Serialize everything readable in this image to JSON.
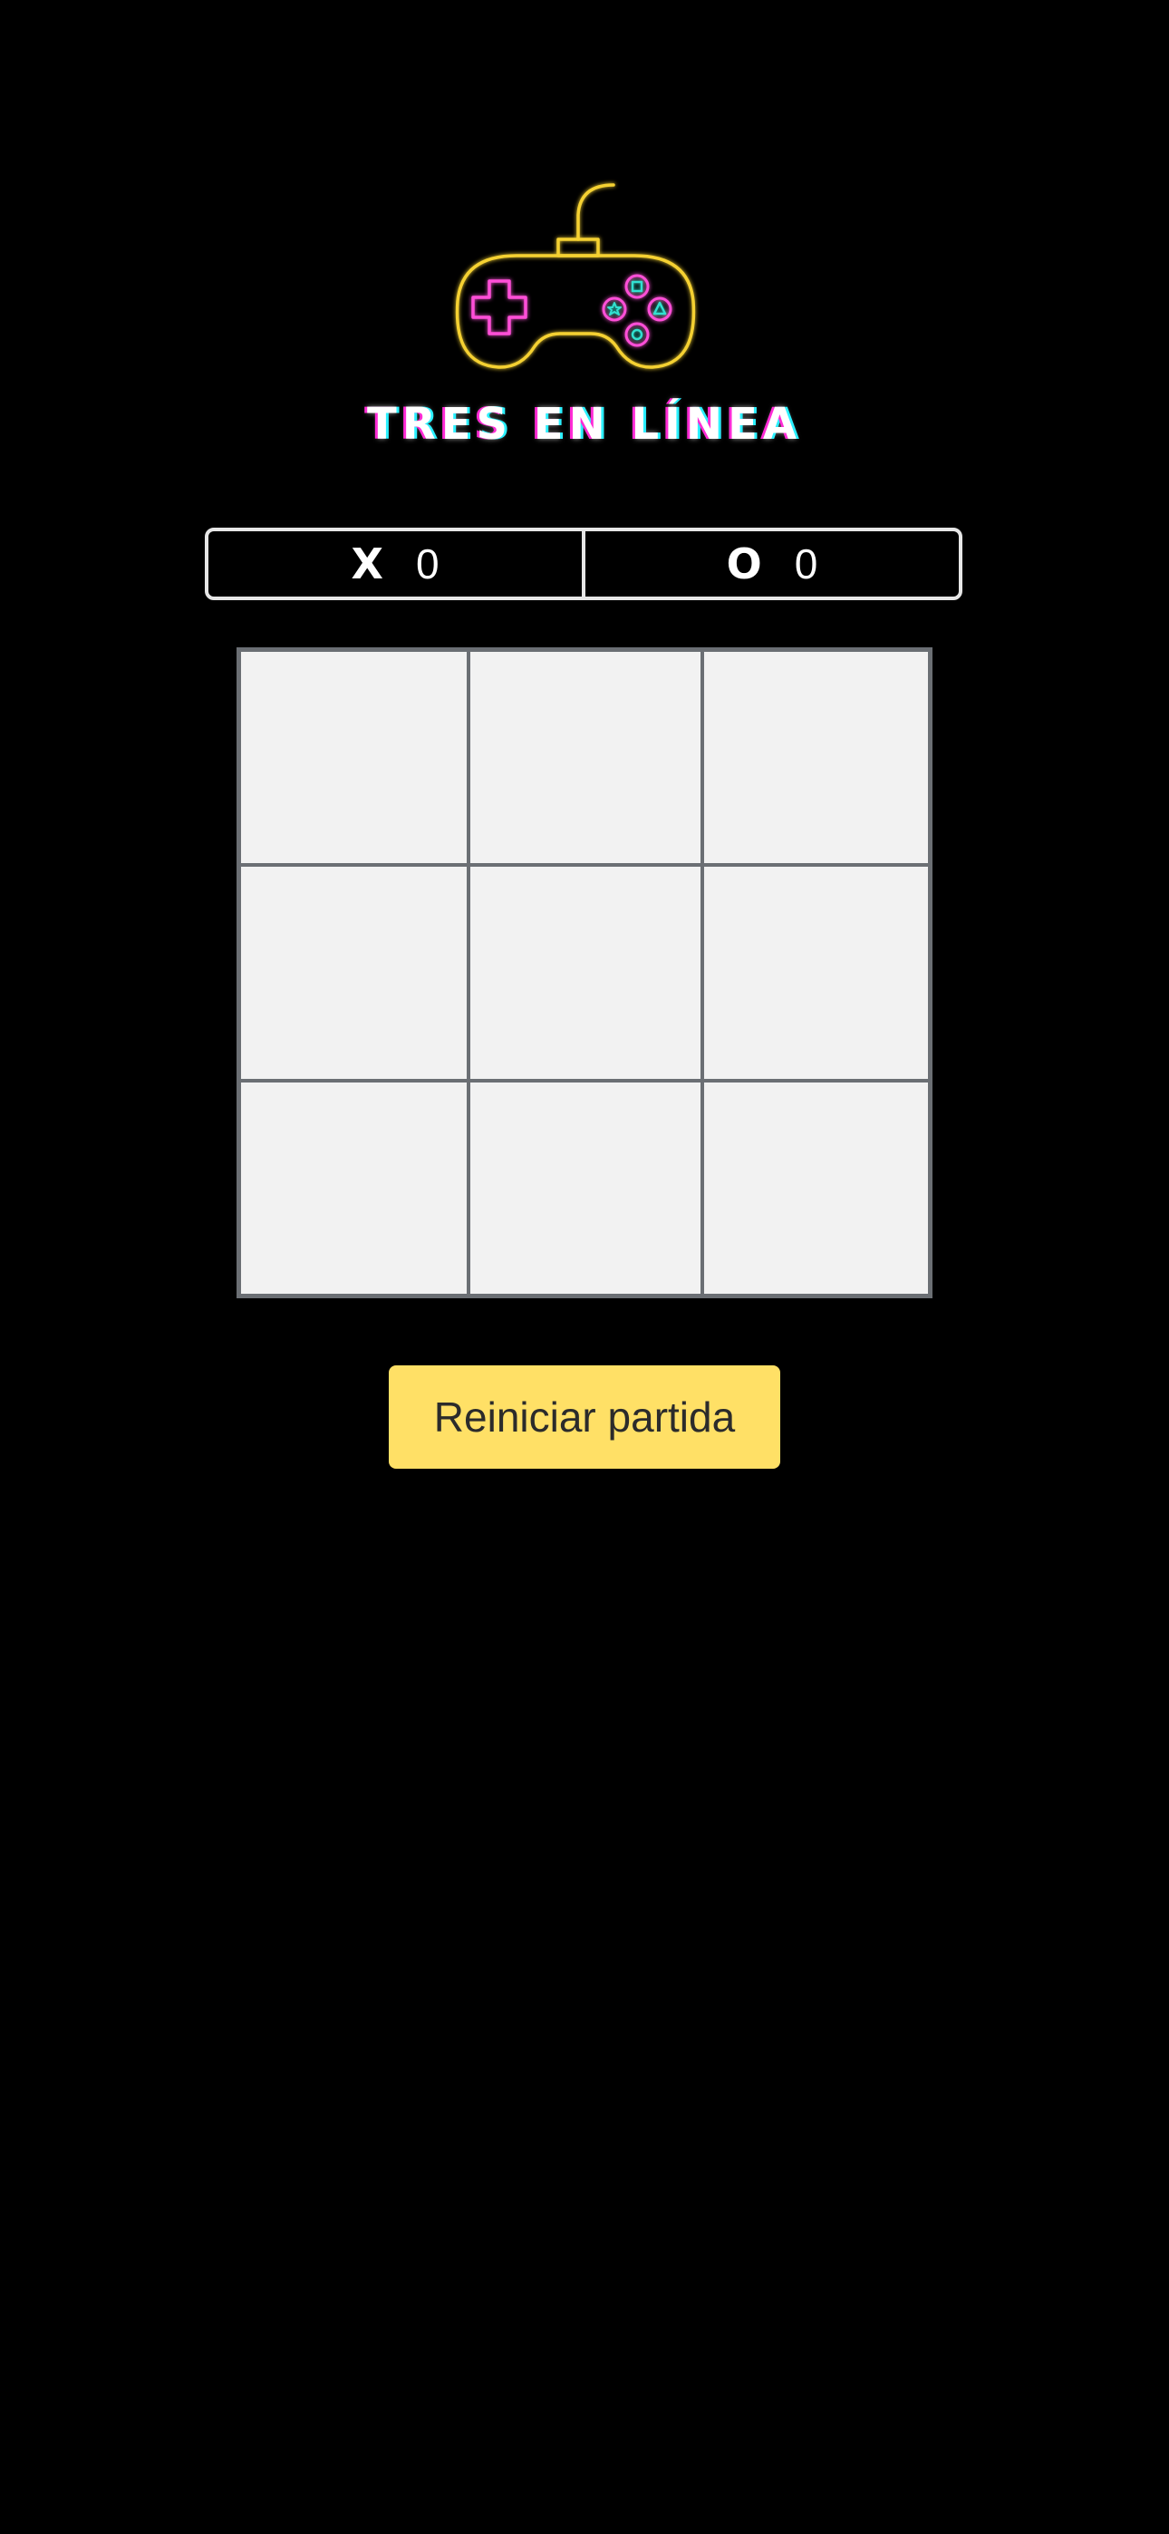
{
  "app": {
    "title": "TRES EN LÍNEA",
    "logo_icon": "gamepad-icon"
  },
  "scoreboard": {
    "player_x": {
      "label": "X",
      "score": "0"
    },
    "player_o": {
      "label": "O",
      "score": "0"
    }
  },
  "board": {
    "cells": [
      "",
      "",
      "",
      "",
      "",
      "",
      "",
      "",
      ""
    ]
  },
  "actions": {
    "reset_label": "Reiniciar partida"
  },
  "colors": {
    "background": "#000000",
    "cell": "#f2f2f2",
    "grid": "#6b6f74",
    "button": "#ffe066",
    "neon_yellow": "#f5d131",
    "neon_pink": "#ff4fd8",
    "neon_cyan": "#31e0d0"
  }
}
